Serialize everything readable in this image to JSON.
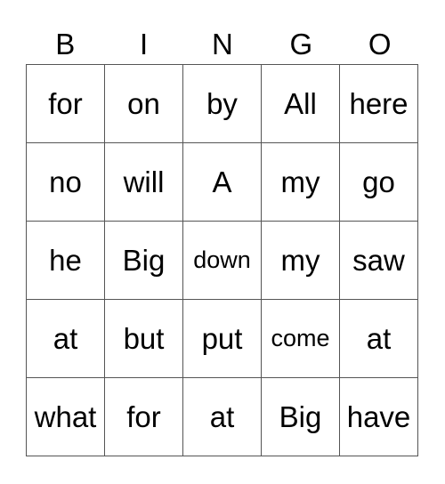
{
  "header": [
    "B",
    "I",
    "N",
    "G",
    "O"
  ],
  "rows": [
    [
      "for",
      "on",
      "by",
      "All",
      "here"
    ],
    [
      "no",
      "will",
      "A",
      "my",
      "go"
    ],
    [
      "he",
      "Big",
      "down",
      "my",
      "saw"
    ],
    [
      "at",
      "but",
      "put",
      "come",
      "at"
    ],
    [
      "what",
      "for",
      "at",
      "Big",
      "have"
    ]
  ]
}
